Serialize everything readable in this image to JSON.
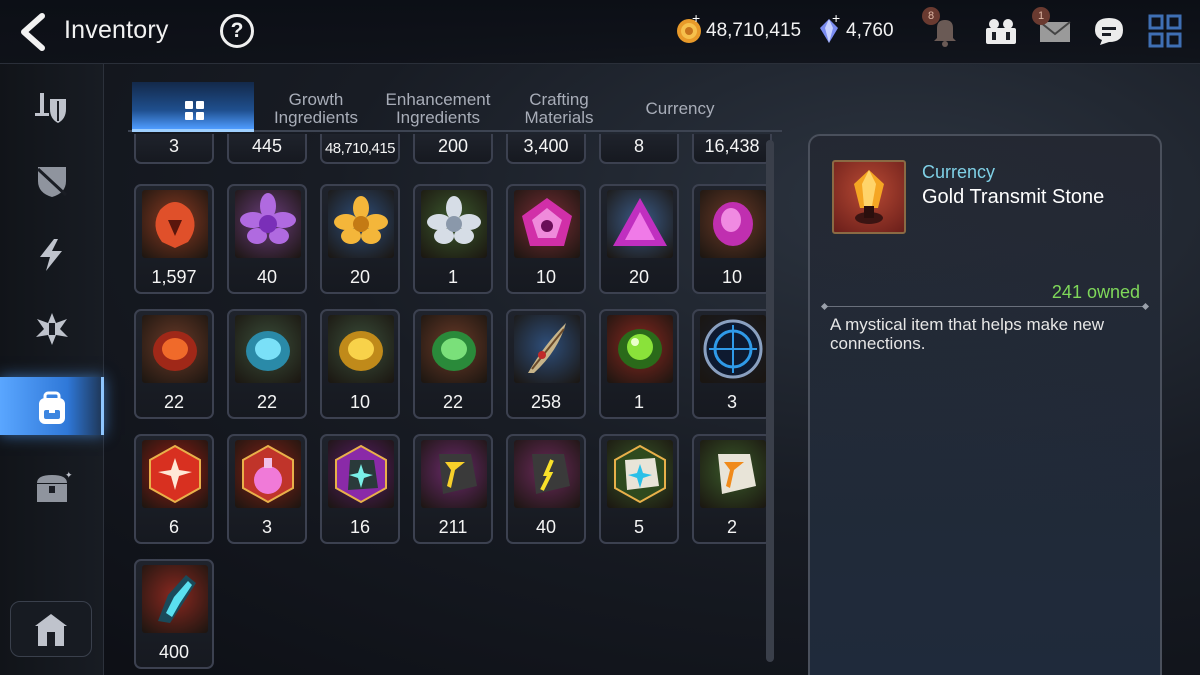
{
  "header": {
    "title": "Inventory",
    "help_label": "?",
    "gold": "48,710,415",
    "gems": "4,760",
    "notification_badge": "8",
    "mail_badge": "1"
  },
  "sidebar": {
    "items": [
      {
        "name": "equipment"
      },
      {
        "name": "artifacts"
      },
      {
        "name": "materials"
      },
      {
        "name": "catalysts"
      },
      {
        "name": "items",
        "active": true
      },
      {
        "name": "storage"
      }
    ]
  },
  "tabs": [
    {
      "label": "",
      "icon": "grid-icon",
      "active": true
    },
    {
      "label_1": "Growth",
      "label_2": "Ingredients"
    },
    {
      "label_1": "Enhancement",
      "label_2": "Ingredients"
    },
    {
      "label_1": "Crafting",
      "label_2": "Materials"
    },
    {
      "label": "Currency"
    }
  ],
  "items": [
    {
      "qty": "3",
      "icon": "partial"
    },
    {
      "qty": "445",
      "icon": "partial"
    },
    {
      "qty": "48,710,415",
      "icon": "partial"
    },
    {
      "qty": "200",
      "icon": "partial"
    },
    {
      "qty": "3,400",
      "icon": "partial"
    },
    {
      "qty": "8",
      "icon": "partial"
    },
    {
      "qty": "16,438",
      "icon": "partial"
    },
    {
      "qty": "1,597",
      "icon": "flame-rune"
    },
    {
      "qty": "40",
      "icon": "purple-flower"
    },
    {
      "qty": "20",
      "icon": "gold-flower"
    },
    {
      "qty": "1",
      "icon": "silver-flower"
    },
    {
      "qty": "10",
      "icon": "purple-pentagon-gem"
    },
    {
      "qty": "20",
      "icon": "purple-triangle-gem"
    },
    {
      "qty": "10",
      "icon": "purple-oval-gem"
    },
    {
      "qty": "22",
      "icon": "red-rune-stone"
    },
    {
      "qty": "22",
      "icon": "blue-rune-stone"
    },
    {
      "qty": "10",
      "icon": "yellow-rune-stone"
    },
    {
      "qty": "22",
      "icon": "green-rune-stone"
    },
    {
      "qty": "258",
      "icon": "feather-bundle"
    },
    {
      "qty": "1",
      "icon": "green-orb"
    },
    {
      "qty": "3",
      "icon": "blue-seal"
    },
    {
      "qty": "6",
      "icon": "red-star-stone"
    },
    {
      "qty": "3",
      "icon": "pink-potion"
    },
    {
      "qty": "16",
      "icon": "cyan-star-stone"
    },
    {
      "qty": "211",
      "icon": "gold-transmit-stone"
    },
    {
      "qty": "40",
      "icon": "charm-stone"
    },
    {
      "qty": "5",
      "icon": "white-star-stone"
    },
    {
      "qty": "2",
      "icon": "orange-transmit-stone"
    },
    {
      "qty": "400",
      "icon": "crystal-shard"
    }
  ],
  "detail": {
    "category": "Currency",
    "name": "Gold Transmit Stone",
    "owned": "241 owned",
    "description": "A mystical item that helps make new connections."
  },
  "colors": {
    "accent_blue": "#4f9cff",
    "owned_green": "#7fd85a",
    "category_cyan": "#7fd0e6"
  }
}
